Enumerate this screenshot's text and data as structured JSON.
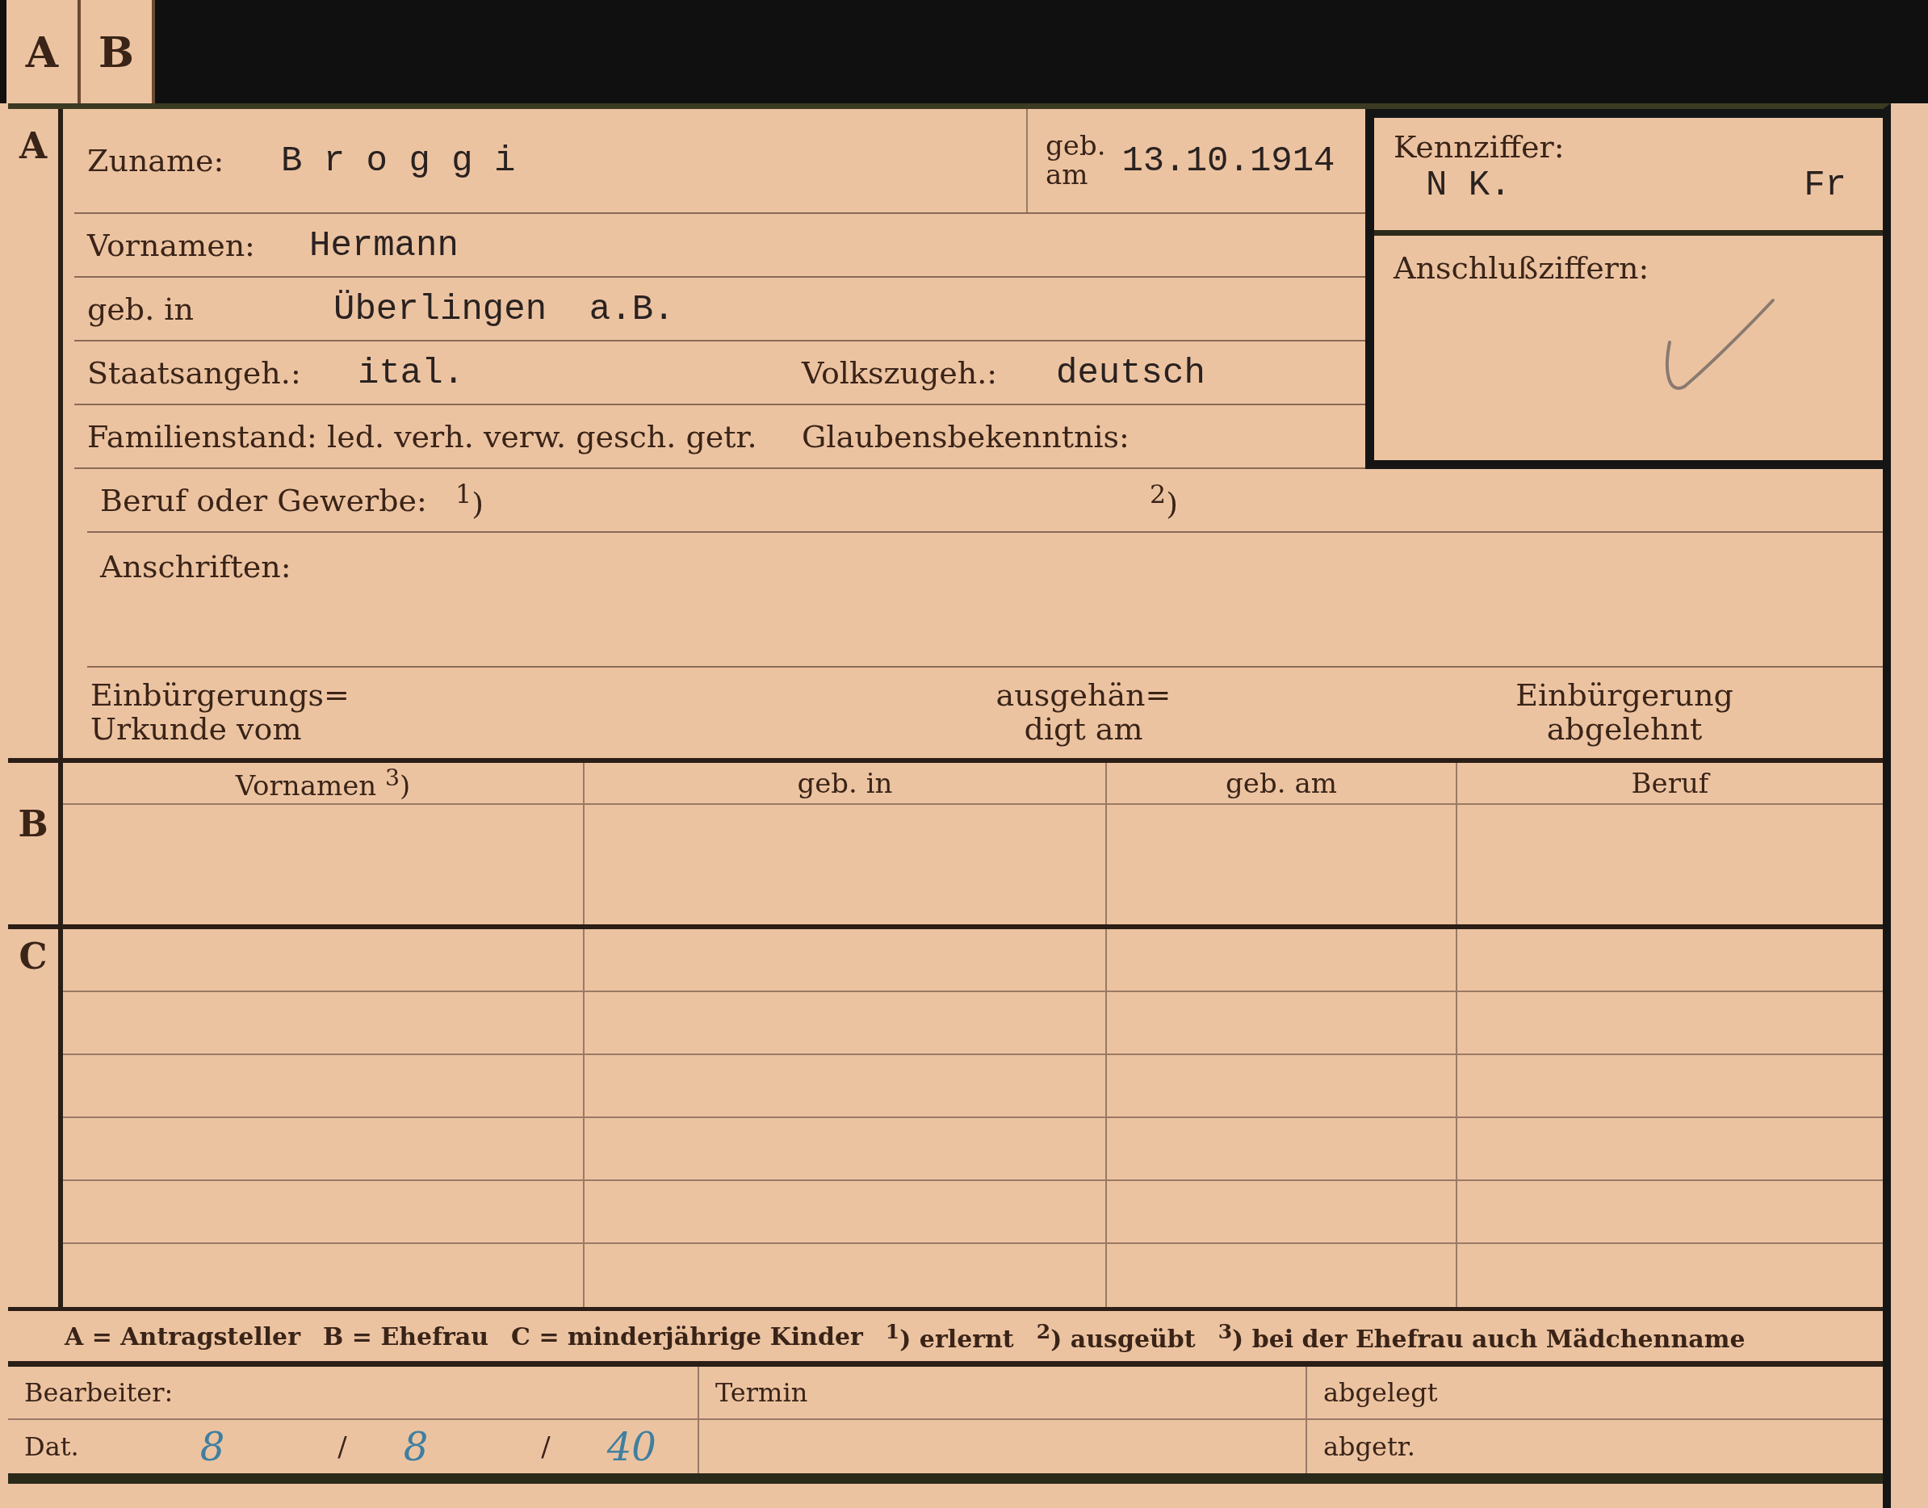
{
  "tabs": [
    {
      "label": "A"
    },
    {
      "label": "B"
    }
  ],
  "section_a": {
    "marker": "A",
    "surname": {
      "label": "Zuname:",
      "value": "B r o g g i"
    },
    "birth_date": {
      "label_lines": [
        "geb.",
        "am"
      ],
      "value": "13.10.1914"
    },
    "code": {
      "label": "Kennziffer:",
      "value": "N K.",
      "suffix": "Fr"
    },
    "link_numbers": {
      "label": "Anschlußziffern:",
      "checked": true
    },
    "first_names": {
      "label": "Vornamen:",
      "value": "Hermann"
    },
    "birthplace": {
      "label": "geb. in",
      "value": "Überlingen  a.B."
    },
    "citizenship": {
      "label": "Staatsangeh.:",
      "value": "ital."
    },
    "ethnicity": {
      "label": "Volkszugeh.:",
      "value": "deutsch"
    },
    "marital_status": {
      "label": "Familienstand: led. verh. verw. gesch. getr."
    },
    "religion": {
      "label": "Glaubensbekenntnis:"
    },
    "occupation": {
      "label": "Beruf oder Gewerbe:",
      "note_1": "$^{1}$)",
      "note_2": "$^{2}$)"
    },
    "addresses": {
      "label": "Anschriften:"
    },
    "naturalization": [
      {
        "lines": [
          "Einbürgerungs=",
          "Urkunde vom"
        ]
      },
      {
        "lines": [
          "ausgehän=",
          "digt am"
        ]
      },
      {
        "lines": [
          "Einbürgerung",
          "abgelehnt"
        ]
      }
    ]
  },
  "section_b": {
    "marker": "B",
    "columns": [
      "Vornamen $^{3}$)",
      "geb. in",
      "geb. am",
      "Beruf"
    ]
  },
  "section_c": {
    "marker": "C"
  },
  "legend": [
    "A = Antragsteller",
    "B = Ehefrau",
    "C = minderjährige Kinder",
    "$^{1}$) erlernt",
    "$^{2}$) ausgeübt",
    "$^{3}$) bei der Ehefrau auch Mädchenname"
  ],
  "footer": {
    "clerk": "Bearbeiter:",
    "date_label": "Dat.",
    "date_parts": [
      {
        "text": "8",
        "kind": "ink"
      },
      {
        "text": "/",
        "kind": "print"
      },
      {
        "text": "8",
        "kind": "ink"
      },
      {
        "text": "/",
        "kind": "print"
      },
      {
        "text": "40",
        "kind": "ink"
      }
    ],
    "deadline": "Termin",
    "filed": "abgelegt",
    "removed": "abgetr."
  }
}
